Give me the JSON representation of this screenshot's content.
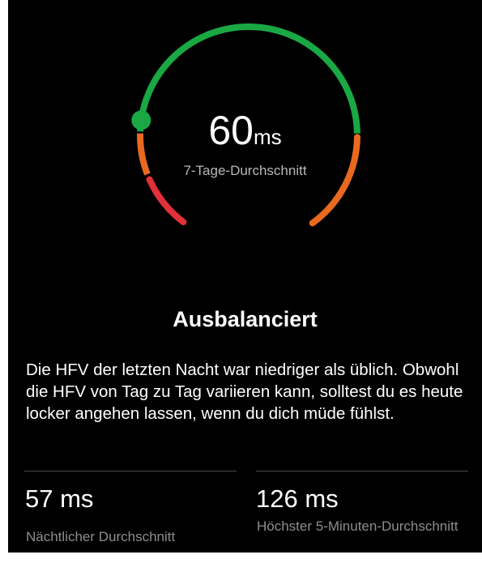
{
  "gauge": {
    "value": "60",
    "unit": "ms",
    "caption": "7-Tage-Durchschnitt",
    "colors": {
      "low": "#e0303a",
      "mid": "#e8691f",
      "high": "#1aa845",
      "indicator": "#1aa845"
    }
  },
  "status": {
    "title": "Ausbalanciert",
    "description": "Die HFV der letzten Nacht war niedriger als üblich. Obwohl die HFV von Tag zu Tag variieren kann, solltest du es heute locker angehen lassen, wenn du dich müde fühlst."
  },
  "metrics": [
    {
      "value": "57 ms",
      "label": "Nächtlicher Durchschnitt"
    },
    {
      "value": "126 ms",
      "label": "Höchster 5-Minuten-Durchschnitt"
    }
  ]
}
